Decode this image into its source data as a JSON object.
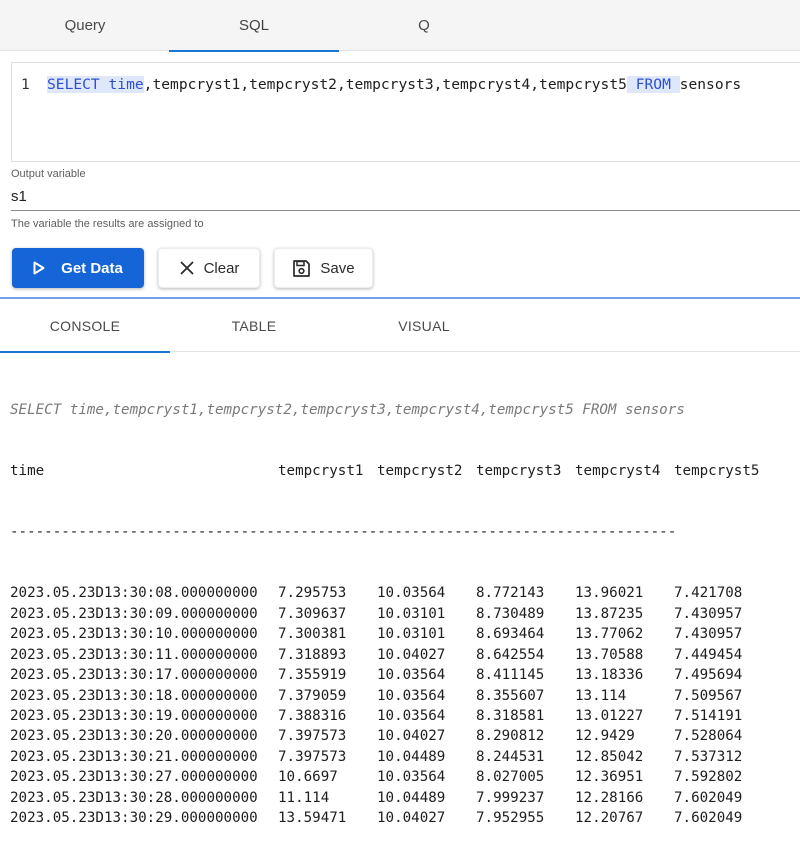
{
  "top_tabs": [
    {
      "label": "Query",
      "active": false
    },
    {
      "label": "SQL",
      "active": true
    },
    {
      "label": "Q",
      "active": false
    }
  ],
  "editor": {
    "line_number": "1",
    "kw_select": "SELECT",
    "col_time": "time",
    "col_rest": ",tempcryst1,tempcryst2,tempcryst3,tempcryst4,tempcryst5",
    "kw_from": "FROM",
    "table": "sensors"
  },
  "output_variable": {
    "label": "Output variable",
    "value": "s1",
    "help": "The variable the results are assigned to"
  },
  "buttons": {
    "get_data": "Get Data",
    "clear": "Clear",
    "save": "Save"
  },
  "bottom_tabs": [
    {
      "label": "CONSOLE",
      "active": true
    },
    {
      "label": "TABLE",
      "active": false
    },
    {
      "label": "VISUAL",
      "active": false
    }
  ],
  "console": {
    "query_echo": "SELECT time,tempcryst1,tempcryst2,tempcryst3,tempcryst4,tempcryst5 FROM sensors",
    "headers": [
      "time",
      "tempcryst1",
      "tempcryst2",
      "tempcryst3",
      "tempcryst4",
      "tempcryst5"
    ],
    "separator": "------------------------------------------------------------------------------",
    "rows": [
      [
        "2023.05.23D13:30:08.000000000",
        "7.295753",
        "10.03564",
        "8.772143",
        "13.96021",
        "7.421708"
      ],
      [
        "2023.05.23D13:30:09.000000000",
        "7.309637",
        "10.03101",
        "8.730489",
        "13.87235",
        "7.430957"
      ],
      [
        "2023.05.23D13:30:10.000000000",
        "7.300381",
        "10.03101",
        "8.693464",
        "13.77062",
        "7.430957"
      ],
      [
        "2023.05.23D13:30:11.000000000",
        "7.318893",
        "10.04027",
        "8.642554",
        "13.70588",
        "7.449454"
      ],
      [
        "2023.05.23D13:30:17.000000000",
        "7.355919",
        "10.03564",
        "8.411145",
        "13.18336",
        "7.495694"
      ],
      [
        "2023.05.23D13:30:18.000000000",
        "7.379059",
        "10.03564",
        "8.355607",
        "13.114",
        "7.509567"
      ],
      [
        "2023.05.23D13:30:19.000000000",
        "7.388316",
        "10.03564",
        "8.318581",
        "13.01227",
        "7.514191"
      ],
      [
        "2023.05.23D13:30:20.000000000",
        "7.397573",
        "10.04027",
        "8.290812",
        "12.9429",
        "7.528064"
      ],
      [
        "2023.05.23D13:30:21.000000000",
        "7.397573",
        "10.04489",
        "8.244531",
        "12.85042",
        "7.537312"
      ],
      [
        "2023.05.23D13:30:27.000000000",
        "10.6697",
        "10.03564",
        "8.027005",
        "12.36951",
        "7.592802"
      ],
      [
        "2023.05.23D13:30:28.000000000",
        "11.114",
        "10.04489",
        "7.999237",
        "12.28166",
        "7.602049"
      ],
      [
        "2023.05.23D13:30:29.000000000",
        "13.59471",
        "10.04027",
        "7.952955",
        "12.20767",
        "7.602049"
      ]
    ]
  },
  "colors": {
    "accent": "#1976d2",
    "primary_button": "#1565d8",
    "keyword": "#2a4fd1",
    "splitter": "#6fa0e8"
  }
}
